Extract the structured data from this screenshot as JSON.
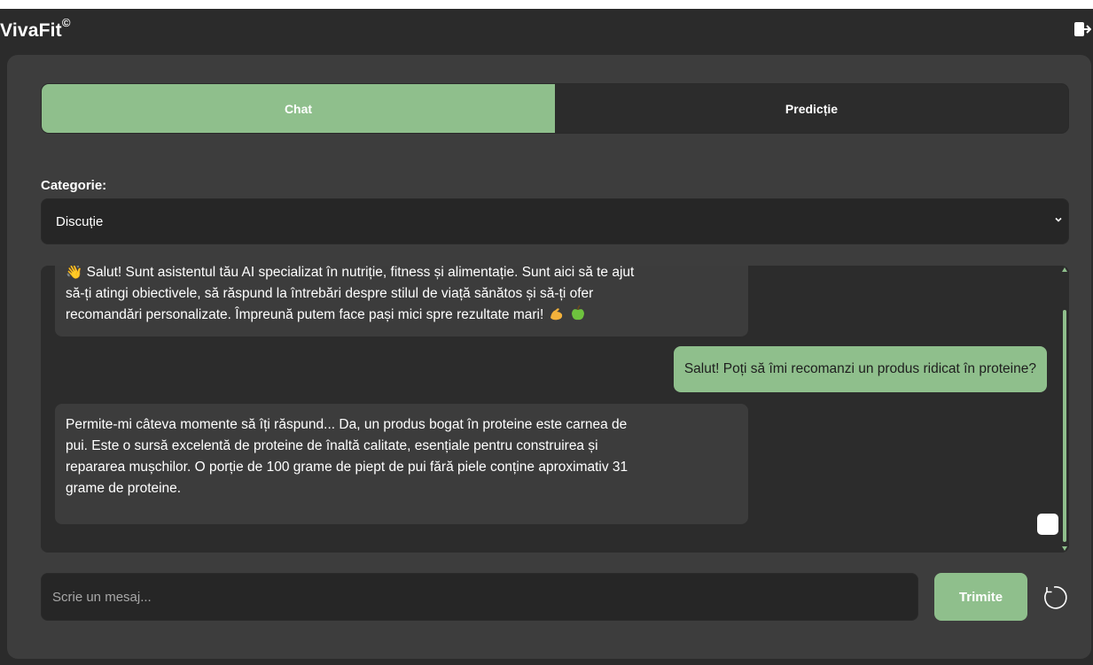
{
  "header": {
    "brand": "VivaFit",
    "brand_mark": "©",
    "logout_icon": "logout-icon"
  },
  "tabs": [
    {
      "label": "Chat",
      "active": true
    },
    {
      "label": "Predicție",
      "active": false
    }
  ],
  "category": {
    "label": "Categorie:",
    "selected": "Discuție"
  },
  "messages": [
    {
      "role": "bot",
      "text_line0": "👋 Salut! Sunt asistentul tău AI specializat în nutriție, fitness și alimentație. Sunt aici să te ajut",
      "text_line1": "să-ți atingi obiectivele, să răspund la întrebări despre stilul de viață sănătos și să-ți ofer",
      "text_line2": "recomandări personalizate. Împreună putem face pași mici spre rezultate mari!"
    },
    {
      "role": "user",
      "text": "Salut! Poți să îmi recomanzi un produs ridicat în proteine?"
    },
    {
      "role": "bot",
      "text_line0": "Permite-mi câteva momente să îți răspund... Da, un produs bogat în proteine este carnea de",
      "text_line1": "pui. Este o sursă excelentă de proteine de înaltă calitate, esențiale pentru construirea și",
      "text_line2": "repararea mușchilor. O porție de 100 grame de piept de pui fără piele conține aproximativ 31",
      "text_line3": "grame de proteine."
    }
  ],
  "composer": {
    "placeholder": "Scrie un mesaj...",
    "send_label": "Trimite",
    "reset_icon": "refresh-icon"
  },
  "colors": {
    "accent": "#8fbf8c",
    "background": "#2b2b2b",
    "panel": "#3d3d3d"
  }
}
